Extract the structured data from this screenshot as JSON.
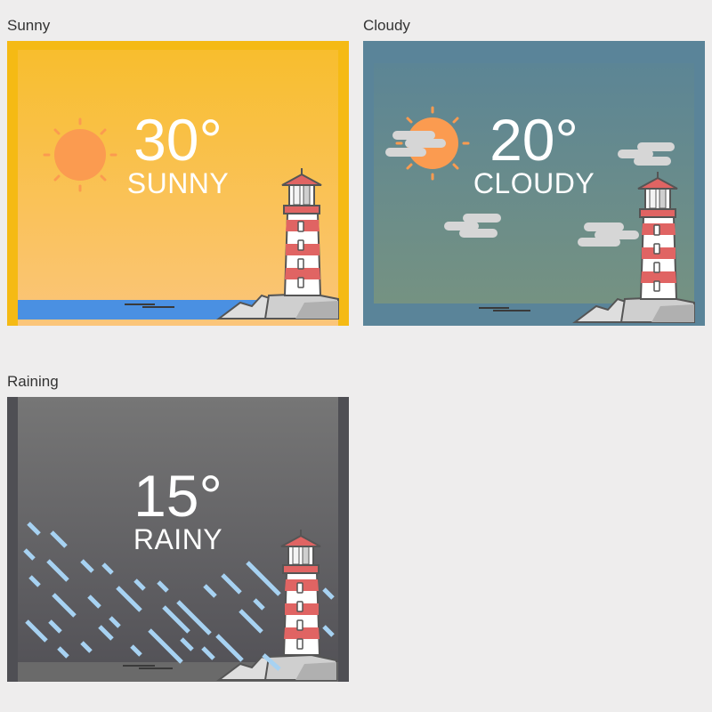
{
  "panels": [
    {
      "label": "Sunny",
      "temp": "30°",
      "condition": "SUNNY"
    },
    {
      "label": "Cloudy",
      "temp": "20°",
      "condition": "CLOUDY"
    },
    {
      "label": "Raining",
      "temp": "15°",
      "condition": "RAINY"
    }
  ],
  "colors": {
    "page_bg": "#eeeded",
    "sunny_frame": "#f5ba14",
    "sunny_sky_top": "#f8be2e",
    "sunny_sky_bottom": "#fbc57a",
    "sea": "#4a90e2",
    "sun": "#fb9b50",
    "cloudy_frame": "#5a8499",
    "cloudy_sky_top": "#5c8595",
    "cloudy_sky_bottom": "#759282",
    "cloud": "#d6d6d6",
    "rainy_frame": "#4f4f54",
    "rainy_sky_top": "#767676",
    "rainy_sky_bottom": "#545358",
    "rain": "#a7d2f2",
    "lighthouse_red": "#e06463",
    "lighthouse_white": "#ffffff",
    "rock": "#dedede"
  },
  "icons": [
    "sun-icon",
    "cloud-icon",
    "rain-icon",
    "lighthouse-icon",
    "boat-icon"
  ]
}
